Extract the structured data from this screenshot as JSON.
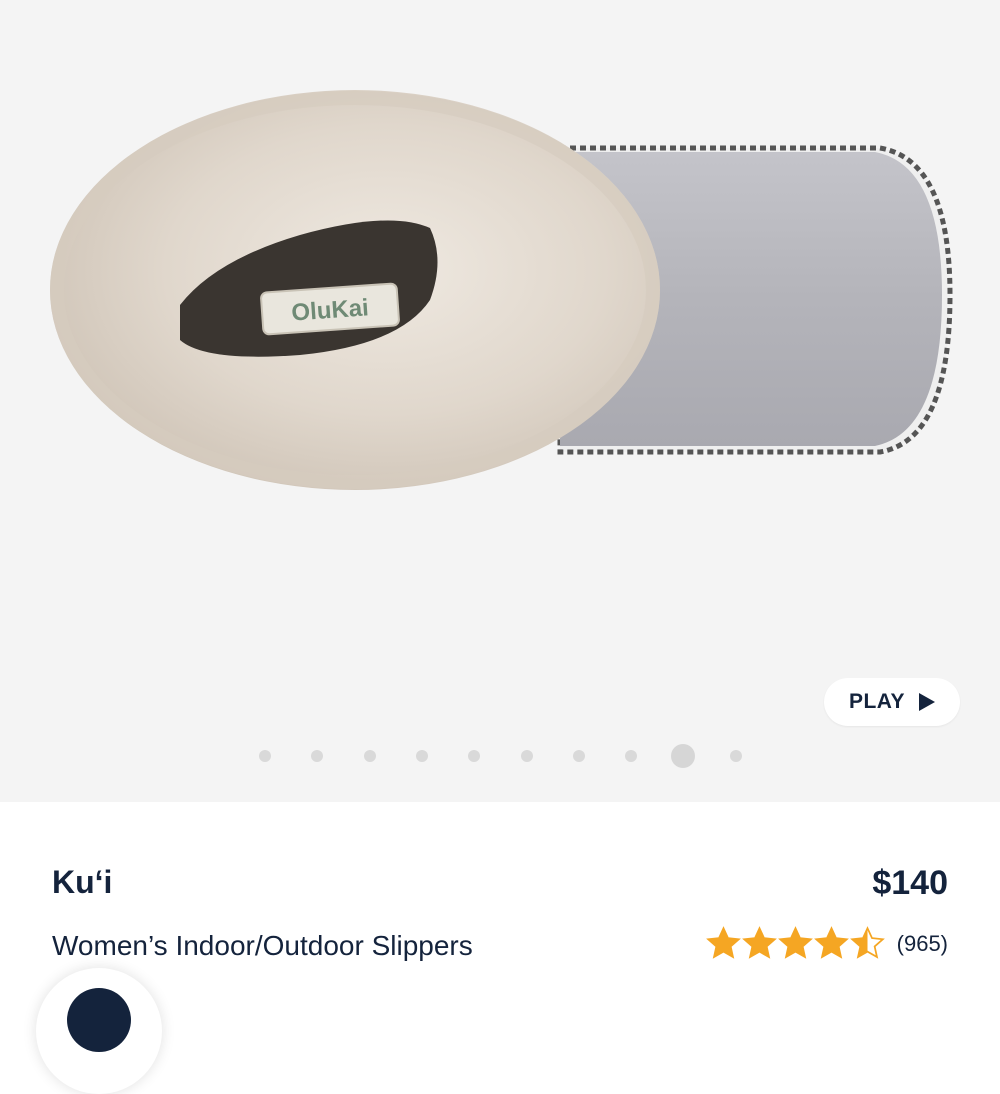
{
  "gallery": {
    "play_label": "PLAY",
    "slide_count": 10,
    "active_slide": 9,
    "logo_text": "OluKai"
  },
  "product": {
    "name": "Ku‘i",
    "price": "$140",
    "subtitle": "Women’s Indoor/Outdoor Slippers",
    "rating": 4.5,
    "review_count": "(965)"
  },
  "colors": {
    "text": "#14233c",
    "star": "#f5a623",
    "gallery_bg": "#f4f4f4"
  },
  "icons": {
    "play": "play-icon",
    "star": "star-icon",
    "chat": "chat-icon"
  }
}
